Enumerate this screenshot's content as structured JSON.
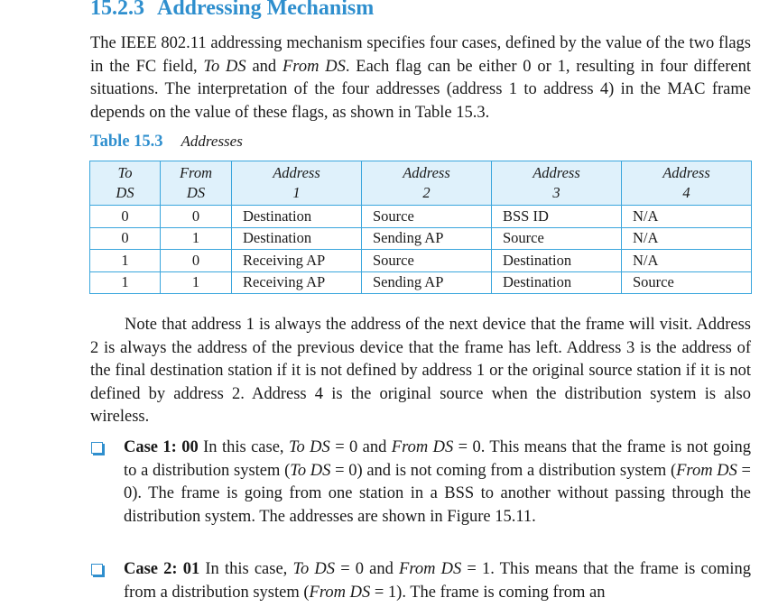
{
  "section": {
    "number": "15.2.3",
    "title": "Addressing Mechanism"
  },
  "intro": {
    "t1": "The IEEE 802.11 addressing mechanism specifies four cases, defined by the value of the two flags in the FC field, ",
    "to_ds": "To DS",
    "t2": " and ",
    "from_ds": "From DS",
    "t3": ". Each flag can be either 0 or 1, resulting in four different situations. The interpretation of the four addresses (address 1 to address 4) in the MAC frame depends on the value of these flags, as shown in Table 15.3."
  },
  "table": {
    "caption_number": "Table 15.3",
    "caption_title": "Addresses",
    "headers": [
      [
        "To",
        "DS"
      ],
      [
        "From",
        "DS"
      ],
      [
        "Address",
        "1"
      ],
      [
        "Address",
        "2"
      ],
      [
        "Address",
        "3"
      ],
      [
        "Address",
        "4"
      ]
    ],
    "rows": [
      [
        "0",
        "0",
        "Destination",
        "Source",
        "BSS ID",
        "N/A"
      ],
      [
        "0",
        "1",
        "Destination",
        "Sending AP",
        "Source",
        "N/A"
      ],
      [
        "1",
        "0",
        "Receiving AP",
        "Source",
        "Destination",
        "N/A"
      ],
      [
        "1",
        "1",
        "Receiving AP",
        "Sending AP",
        "Destination",
        "Source"
      ]
    ]
  },
  "note": "Note that address 1 is always the address of the next device that the frame will visit. Address 2 is always the address of the previous device that the frame has left. Address 3 is the address of the final destination station if it is not defined by address 1 or the original source station if it is not defined by address 2.  Address 4 is the original source when the distribution system is also wireless.",
  "case1": {
    "label": "Case 1: 00",
    "s1": "  In this case, ",
    "to_ds": "To DS",
    "s2": " = 0 and ",
    "from_ds": "From DS",
    "s3": " = 0. This means that the frame is not going to a distribution system (",
    "to_ds_b": "To DS",
    "s4": " = 0) and is not coming from a distribution system (",
    "from_ds_b": "From DS",
    "s5": " = 0). The frame is going from one station in a BSS to another without passing through the distribution system. The addresses are shown in Figure 15.11."
  },
  "case2": {
    "label": "Case 2: 01",
    "s1": "  In this case, ",
    "to_ds": "To DS",
    "s2": " = 0 and ",
    "from_ds": "From DS",
    "s3": " = 1. This means that the frame is coming from a distribution system (",
    "from_ds_b": "From DS",
    "s4": " = 1). The frame is coming from an"
  }
}
